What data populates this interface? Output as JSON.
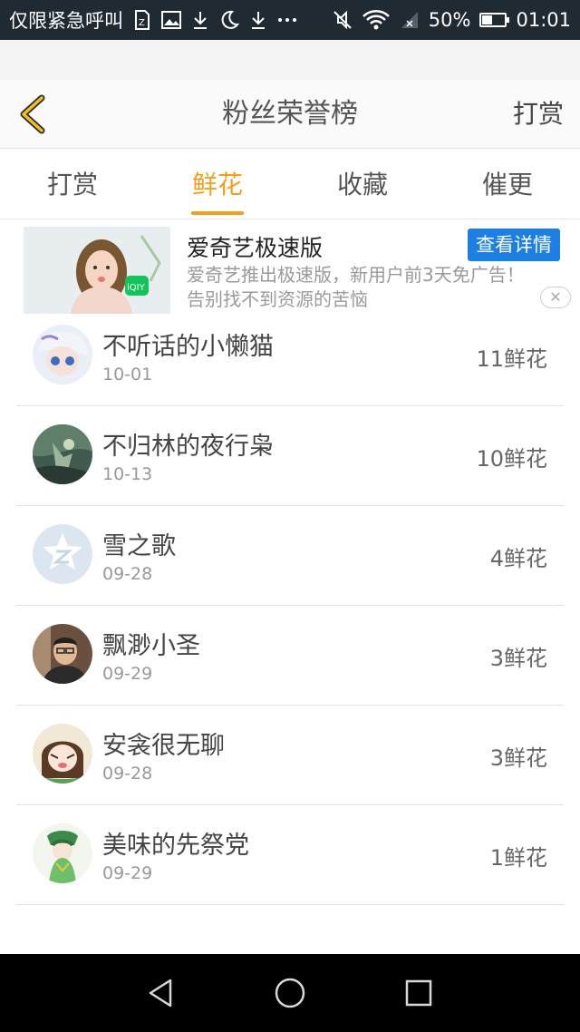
{
  "status_bar": {
    "carrier": "仅限紧急呼叫",
    "battery_percent": "50%",
    "battery_level": 0.5,
    "time": "01:01",
    "icons": [
      "sim-icon",
      "image-icon",
      "download-icon",
      "moon-icon",
      "download-icon",
      "more-icon",
      "mute-icon",
      "wifi-icon",
      "signal-icon",
      "battery-icon"
    ]
  },
  "header": {
    "title": "粉丝荣誉榜",
    "right_action": "打赏",
    "back_icon": "chevron-left-icon",
    "accent_color": "#f0c020"
  },
  "tabs": [
    {
      "label": "打赏",
      "active": false
    },
    {
      "label": "鲜花",
      "active": true
    },
    {
      "label": "收藏",
      "active": false
    },
    {
      "label": "催更",
      "active": false
    }
  ],
  "ad": {
    "title": "爱奇艺极速版",
    "description": "爱奇艺推出极速版，新用户前3天免广告！告别找不到资源的苦恼",
    "button_label": "查看详情",
    "close_label": "✕",
    "logo_text": "iQIY"
  },
  "fans": [
    {
      "name": "不听话的小懒猫",
      "date": "10-01",
      "count": "11鲜花"
    },
    {
      "name": "不归林的夜行枭",
      "date": "10-13",
      "count": "10鲜花"
    },
    {
      "name": "雪之歌",
      "date": "09-28",
      "count": "4鲜花"
    },
    {
      "name": "飘渺小圣",
      "date": "09-29",
      "count": "3鲜花"
    },
    {
      "name": "安衾很无聊",
      "date": "09-28",
      "count": "3鲜花"
    },
    {
      "name": "美味的先祭党",
      "date": "09-29",
      "count": "1鲜花"
    }
  ],
  "nav": {
    "buttons": [
      "back-triangle-icon",
      "home-circle-icon",
      "recents-square-icon"
    ]
  }
}
